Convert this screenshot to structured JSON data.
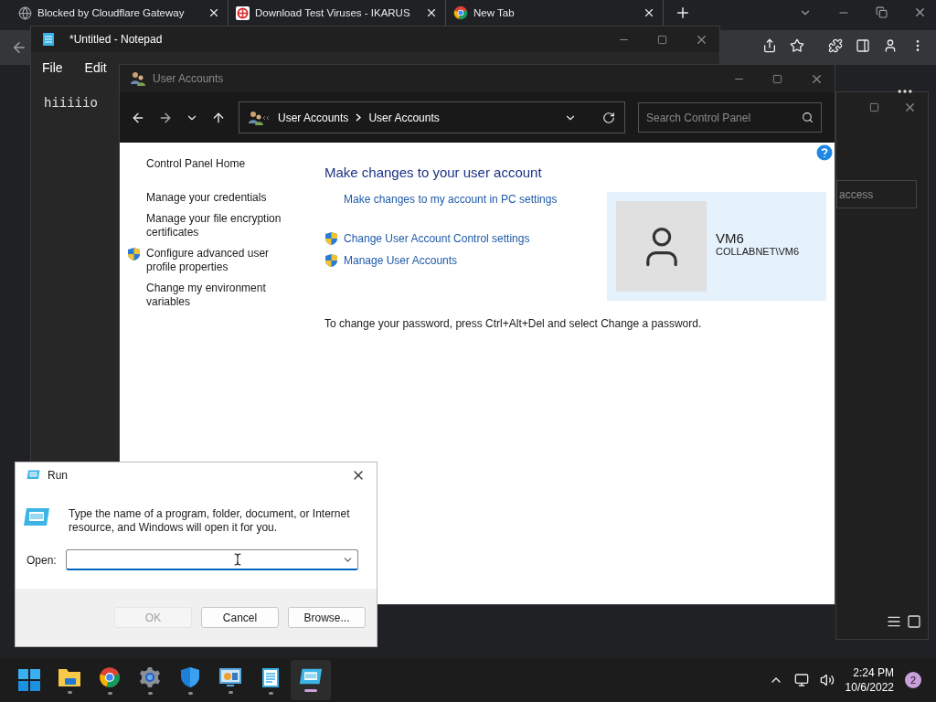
{
  "browser": {
    "tabs": [
      {
        "title": "Blocked by Cloudflare Gateway"
      },
      {
        "title": "Download Test Viruses - IKARUS"
      },
      {
        "title": "New Tab"
      }
    ]
  },
  "notepad": {
    "title": "*Untitled - Notepad",
    "menu": [
      "File",
      "Edit"
    ],
    "text": "hiiiiio"
  },
  "user_accounts": {
    "title": "User Accounts",
    "breadcrumb": [
      "User Accounts",
      "User Accounts"
    ],
    "search": {
      "placeholder": "Search Control Panel"
    },
    "sidebar": {
      "home": "Control Panel Home",
      "items": [
        {
          "label": "Manage your credentials",
          "shield": false
        },
        {
          "label": "Manage your file encryption certificates",
          "shield": false
        },
        {
          "label": "Configure advanced user profile properties",
          "shield": true
        },
        {
          "label": "Change my environment variables",
          "shield": false
        }
      ]
    },
    "heading": "Make changes to your user account",
    "links": [
      {
        "label": "Make changes to my account in PC settings",
        "shield": false
      },
      {
        "label": "Change User Account Control settings",
        "shield": true
      },
      {
        "label": "Manage User Accounts",
        "shield": true
      }
    ],
    "note": "To change your password, press Ctrl+Alt+Del and select Change a password.",
    "account": {
      "name": "VM6",
      "domain": "COLLABNET\\VM6"
    }
  },
  "background_window": {
    "field_text": "access"
  },
  "run": {
    "title": "Run",
    "description": "Type the name of a program, folder, document, or Internet resource, and Windows will open it for you.",
    "open_label": "Open:",
    "buttons": [
      {
        "label": "OK",
        "disabled": true
      },
      {
        "label": "Cancel",
        "disabled": false
      },
      {
        "label": "Browse...",
        "disabled": false
      }
    ]
  },
  "taskbar": {
    "apps": [
      {
        "kind": "start",
        "active": false
      },
      {
        "kind": "folder",
        "active": false
      },
      {
        "kind": "chrome",
        "active": false
      },
      {
        "kind": "gear",
        "active": false
      },
      {
        "kind": "shield",
        "active": false
      },
      {
        "kind": "monitor",
        "active": false
      },
      {
        "kind": "notepad",
        "active": false
      },
      {
        "kind": "run",
        "active": true
      }
    ],
    "time": "2:24 PM",
    "date": "10/6/2022",
    "notifications": "2"
  }
}
